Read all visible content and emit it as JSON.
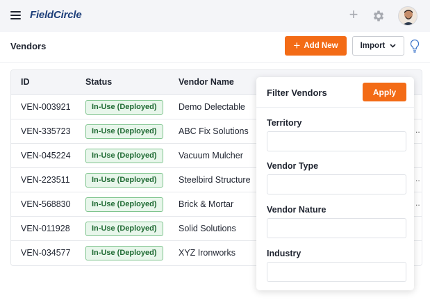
{
  "app": {
    "logo": "FieldCircle"
  },
  "header": {
    "title": "Vendors",
    "add_label": "Add New",
    "import_label": "Import"
  },
  "table": {
    "columns": [
      "ID",
      "Status",
      "Vendor Name"
    ],
    "rows": [
      {
        "id": "VEN-003921",
        "status": "In-Use (Deployed)",
        "name": "Demo Delectable"
      },
      {
        "id": "VEN-335723",
        "status": "In-Use (Deployed)",
        "name": "ABC Fix Solutions"
      },
      {
        "id": "VEN-045224",
        "status": "In-Use (Deployed)",
        "name": "Vacuum Mulcher"
      },
      {
        "id": "VEN-223511",
        "status": "In-Use (Deployed)",
        "name": "Steelbird Structure"
      },
      {
        "id": "VEN-568830",
        "status": "In-Use (Deployed)",
        "name": "Brick & Mortar"
      },
      {
        "id": "VEN-011928",
        "status": "In-Use (Deployed)",
        "name": "Solid Solutions"
      },
      {
        "id": "VEN-034577",
        "status": "In-Use (Deployed)",
        "name": "XYZ Ironworks"
      }
    ]
  },
  "filter": {
    "title": "Filter Vendors",
    "apply_label": "Apply",
    "fields": [
      {
        "label": "Territory",
        "value": ""
      },
      {
        "label": "Vendor Type",
        "value": ""
      },
      {
        "label": "Vendor Nature",
        "value": ""
      },
      {
        "label": "Industry",
        "value": ""
      }
    ]
  },
  "icons": {
    "menu": "hamburger-icon",
    "add": "plus-icon",
    "settings": "gear-icon",
    "profile": "avatar",
    "import_dropdown": "chevron-down-icon",
    "help": "lightbulb-icon"
  },
  "colors": {
    "accent": "#f36b16",
    "logo": "#1d3f7a",
    "status_bg": "#e8f6eb",
    "status_border": "#7fc48e",
    "status_text": "#1f6a33"
  }
}
